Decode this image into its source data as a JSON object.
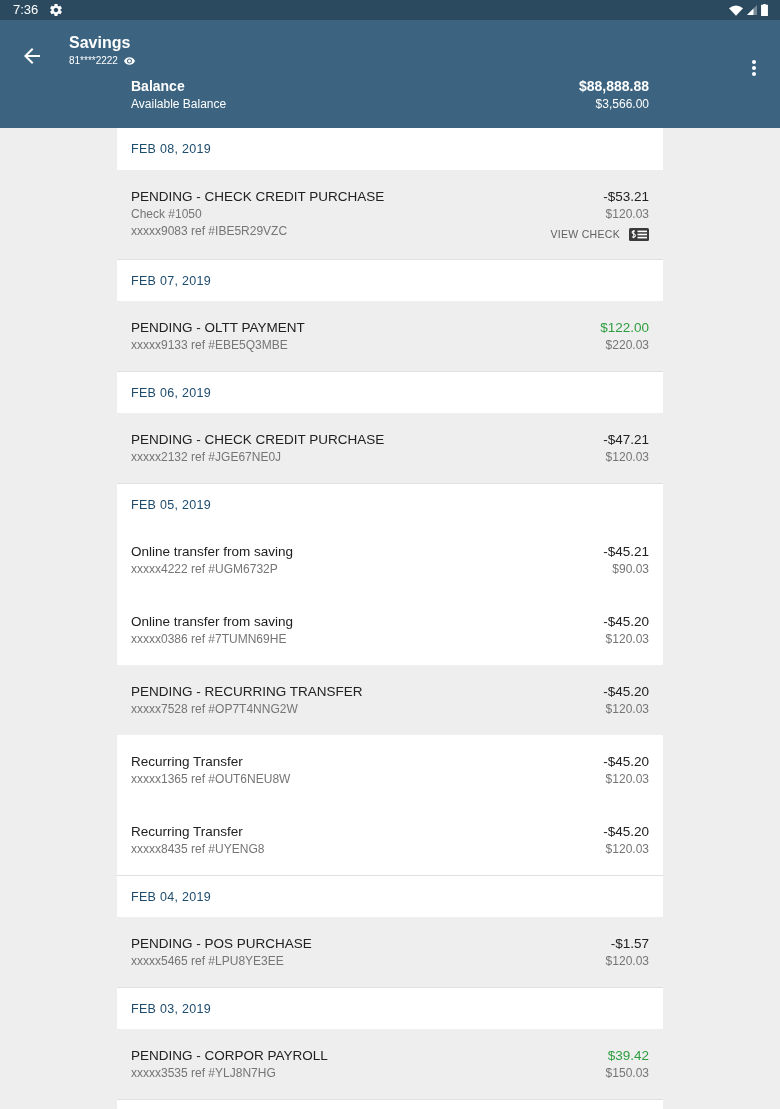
{
  "status_bar": {
    "time": "7:36"
  },
  "app_bar": {
    "title": "Savings",
    "account_number": "81****2222"
  },
  "balance": {
    "label": "Balance",
    "value": "$88,888.88",
    "available_label": "Available Balance",
    "available_value": "$3,566.00"
  },
  "groups": [
    {
      "date": "FEB 08, 2019",
      "transactions": [
        {
          "title": "PENDING - CHECK CREDIT PURCHASE",
          "details": [
            "Check #1050",
            "xxxxx9083 ref #IBE5R29VZC"
          ],
          "amount": "-$53.21",
          "kind": "debit",
          "balance": "$120.03",
          "pending": true,
          "action": "VIEW CHECK"
        }
      ]
    },
    {
      "date": "FEB 07, 2019",
      "transactions": [
        {
          "title": "PENDING - OLTT PAYMENT",
          "details": [
            "xxxxx9133 ref #EBE5Q3MBE"
          ],
          "amount": "$122.00",
          "kind": "credit",
          "balance": "$220.03",
          "pending": true
        }
      ]
    },
    {
      "date": "FEB 06, 2019",
      "transactions": [
        {
          "title": "PENDING - CHECK CREDIT PURCHASE",
          "details": [
            "xxxxx2132 ref #JGE67NE0J"
          ],
          "amount": "-$47.21",
          "kind": "debit",
          "balance": "$120.03",
          "pending": true
        }
      ]
    },
    {
      "date": "FEB 05, 2019",
      "transactions": [
        {
          "title": "Online transfer from saving",
          "details": [
            "xxxxx4222 ref #UGM6732P"
          ],
          "amount": "-$45.21",
          "kind": "debit",
          "balance": "$90.03",
          "pending": false
        },
        {
          "title": "Online transfer from saving",
          "details": [
            "xxxxx0386 ref #7TUMN69HE"
          ],
          "amount": "-$45.20",
          "kind": "debit",
          "balance": "$120.03",
          "pending": false
        },
        {
          "title": "PENDING - RECURRING TRANSFER",
          "details": [
            "xxxxx7528 ref #OP7T4NNG2W"
          ],
          "amount": "-$45.20",
          "kind": "debit",
          "balance": "$120.03",
          "pending": true
        },
        {
          "title": "Recurring Transfer",
          "details": [
            "xxxxx1365 ref #OUT6NEU8W"
          ],
          "amount": "-$45.20",
          "kind": "debit",
          "balance": "$120.03",
          "pending": false
        },
        {
          "title": "Recurring Transfer",
          "details": [
            "xxxxx8435 ref #UYENG8"
          ],
          "amount": "-$45.20",
          "kind": "debit",
          "balance": "$120.03",
          "pending": false
        }
      ]
    },
    {
      "date": "FEB 04, 2019",
      "transactions": [
        {
          "title": "PENDING - POS PURCHASE",
          "details": [
            "xxxxx5465 ref #LPU8YE3EE"
          ],
          "amount": "-$1.57",
          "kind": "debit",
          "balance": "$120.03",
          "pending": true
        }
      ]
    },
    {
      "date": "FEB 03, 2019",
      "transactions": [
        {
          "title": "PENDING - CORPOR PAYROLL",
          "details": [
            "xxxxx3535 ref #YLJ8N7HG"
          ],
          "amount": "$39.42",
          "kind": "credit",
          "balance": "$150.03",
          "pending": true
        }
      ]
    }
  ]
}
